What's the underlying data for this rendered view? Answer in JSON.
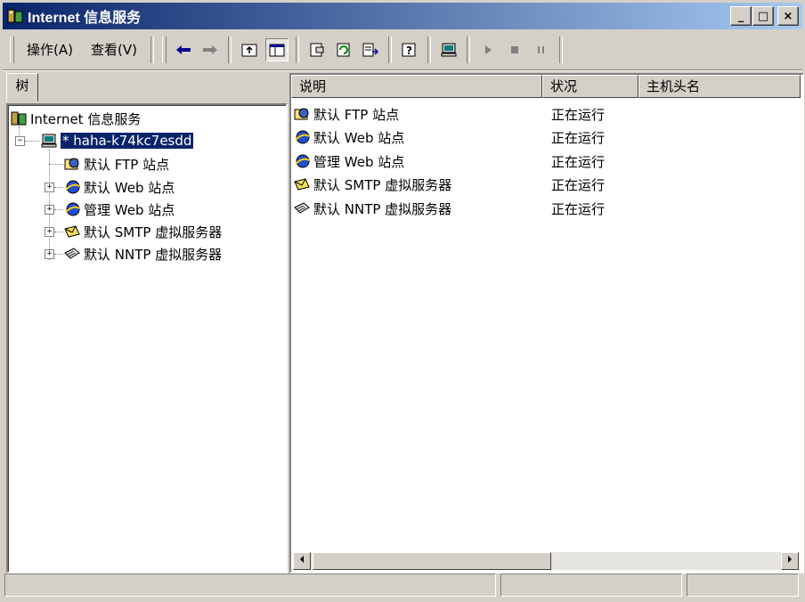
{
  "window": {
    "title": "Internet 信息服务"
  },
  "title_buttons": {
    "minimize": "_",
    "maximize": "□",
    "close": "×"
  },
  "menu": [
    {
      "label": "操作(A)"
    },
    {
      "label": "查看(V)"
    }
  ],
  "toolbar_icons": [
    "back-icon",
    "forward-icon",
    "up-folder-icon",
    "show-tree-icon",
    "properties-icon",
    "refresh-icon",
    "export-list-icon",
    "help-icon",
    "computer-icon",
    "play-icon",
    "stop-icon",
    "pause-icon"
  ],
  "tabs": {
    "tree": "树"
  },
  "tree": {
    "root": "Internet 信息服务",
    "computer": "* haha-k74kc7esdd",
    "children": [
      {
        "label": "默认 FTP 站点",
        "icon": "ftp-site-icon"
      },
      {
        "label": "默认 Web 站点",
        "icon": "web-site-icon"
      },
      {
        "label": "管理 Web 站点",
        "icon": "web-site-icon"
      },
      {
        "label": "默认 SMTP 虚拟服务器",
        "icon": "smtp-icon"
      },
      {
        "label": "默认 NNTP 虚拟服务器",
        "icon": "nntp-icon"
      }
    ]
  },
  "list": {
    "columns": [
      "说明",
      "状况",
      "主机头名"
    ],
    "rows": [
      {
        "name": "默认 FTP 站点",
        "status": "正在运行",
        "icon": "ftp-site-icon"
      },
      {
        "name": "默认 Web 站点",
        "status": "正在运行",
        "icon": "web-site-icon"
      },
      {
        "name": "管理 Web 站点",
        "status": "正在运行",
        "icon": "web-site-icon"
      },
      {
        "name": "默认 SMTP 虚拟服务器",
        "status": "正在运行",
        "icon": "smtp-icon"
      },
      {
        "name": "默认 NNTP 虚拟服务器",
        "status": "正在运行",
        "icon": "nntp-icon"
      }
    ]
  },
  "colors": {
    "title_active": "#0a246a",
    "selection": "#0a246a",
    "face": "#d4d0c8"
  }
}
